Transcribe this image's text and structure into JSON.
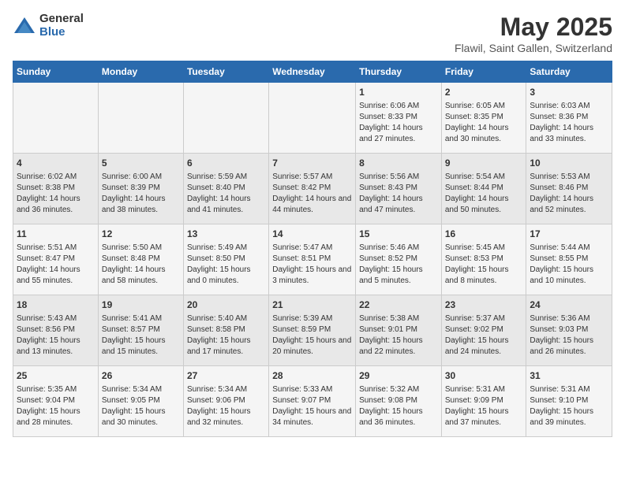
{
  "logo": {
    "general": "General",
    "blue": "Blue"
  },
  "header": {
    "title": "May 2025",
    "subtitle": "Flawil, Saint Gallen, Switzerland"
  },
  "weekdays": [
    "Sunday",
    "Monday",
    "Tuesday",
    "Wednesday",
    "Thursday",
    "Friday",
    "Saturday"
  ],
  "weeks": [
    [
      {
        "day": "",
        "content": ""
      },
      {
        "day": "",
        "content": ""
      },
      {
        "day": "",
        "content": ""
      },
      {
        "day": "",
        "content": ""
      },
      {
        "day": "1",
        "content": "Sunrise: 6:06 AM\nSunset: 8:33 PM\nDaylight: 14 hours and 27 minutes."
      },
      {
        "day": "2",
        "content": "Sunrise: 6:05 AM\nSunset: 8:35 PM\nDaylight: 14 hours and 30 minutes."
      },
      {
        "day": "3",
        "content": "Sunrise: 6:03 AM\nSunset: 8:36 PM\nDaylight: 14 hours and 33 minutes."
      }
    ],
    [
      {
        "day": "4",
        "content": "Sunrise: 6:02 AM\nSunset: 8:38 PM\nDaylight: 14 hours and 36 minutes."
      },
      {
        "day": "5",
        "content": "Sunrise: 6:00 AM\nSunset: 8:39 PM\nDaylight: 14 hours and 38 minutes."
      },
      {
        "day": "6",
        "content": "Sunrise: 5:59 AM\nSunset: 8:40 PM\nDaylight: 14 hours and 41 minutes."
      },
      {
        "day": "7",
        "content": "Sunrise: 5:57 AM\nSunset: 8:42 PM\nDaylight: 14 hours and 44 minutes."
      },
      {
        "day": "8",
        "content": "Sunrise: 5:56 AM\nSunset: 8:43 PM\nDaylight: 14 hours and 47 minutes."
      },
      {
        "day": "9",
        "content": "Sunrise: 5:54 AM\nSunset: 8:44 PM\nDaylight: 14 hours and 50 minutes."
      },
      {
        "day": "10",
        "content": "Sunrise: 5:53 AM\nSunset: 8:46 PM\nDaylight: 14 hours and 52 minutes."
      }
    ],
    [
      {
        "day": "11",
        "content": "Sunrise: 5:51 AM\nSunset: 8:47 PM\nDaylight: 14 hours and 55 minutes."
      },
      {
        "day": "12",
        "content": "Sunrise: 5:50 AM\nSunset: 8:48 PM\nDaylight: 14 hours and 58 minutes."
      },
      {
        "day": "13",
        "content": "Sunrise: 5:49 AM\nSunset: 8:50 PM\nDaylight: 15 hours and 0 minutes."
      },
      {
        "day": "14",
        "content": "Sunrise: 5:47 AM\nSunset: 8:51 PM\nDaylight: 15 hours and 3 minutes."
      },
      {
        "day": "15",
        "content": "Sunrise: 5:46 AM\nSunset: 8:52 PM\nDaylight: 15 hours and 5 minutes."
      },
      {
        "day": "16",
        "content": "Sunrise: 5:45 AM\nSunset: 8:53 PM\nDaylight: 15 hours and 8 minutes."
      },
      {
        "day": "17",
        "content": "Sunrise: 5:44 AM\nSunset: 8:55 PM\nDaylight: 15 hours and 10 minutes."
      }
    ],
    [
      {
        "day": "18",
        "content": "Sunrise: 5:43 AM\nSunset: 8:56 PM\nDaylight: 15 hours and 13 minutes."
      },
      {
        "day": "19",
        "content": "Sunrise: 5:41 AM\nSunset: 8:57 PM\nDaylight: 15 hours and 15 minutes."
      },
      {
        "day": "20",
        "content": "Sunrise: 5:40 AM\nSunset: 8:58 PM\nDaylight: 15 hours and 17 minutes."
      },
      {
        "day": "21",
        "content": "Sunrise: 5:39 AM\nSunset: 8:59 PM\nDaylight: 15 hours and 20 minutes."
      },
      {
        "day": "22",
        "content": "Sunrise: 5:38 AM\nSunset: 9:01 PM\nDaylight: 15 hours and 22 minutes."
      },
      {
        "day": "23",
        "content": "Sunrise: 5:37 AM\nSunset: 9:02 PM\nDaylight: 15 hours and 24 minutes."
      },
      {
        "day": "24",
        "content": "Sunrise: 5:36 AM\nSunset: 9:03 PM\nDaylight: 15 hours and 26 minutes."
      }
    ],
    [
      {
        "day": "25",
        "content": "Sunrise: 5:35 AM\nSunset: 9:04 PM\nDaylight: 15 hours and 28 minutes."
      },
      {
        "day": "26",
        "content": "Sunrise: 5:34 AM\nSunset: 9:05 PM\nDaylight: 15 hours and 30 minutes."
      },
      {
        "day": "27",
        "content": "Sunrise: 5:34 AM\nSunset: 9:06 PM\nDaylight: 15 hours and 32 minutes."
      },
      {
        "day": "28",
        "content": "Sunrise: 5:33 AM\nSunset: 9:07 PM\nDaylight: 15 hours and 34 minutes."
      },
      {
        "day": "29",
        "content": "Sunrise: 5:32 AM\nSunset: 9:08 PM\nDaylight: 15 hours and 36 minutes."
      },
      {
        "day": "30",
        "content": "Sunrise: 5:31 AM\nSunset: 9:09 PM\nDaylight: 15 hours and 37 minutes."
      },
      {
        "day": "31",
        "content": "Sunrise: 5:31 AM\nSunset: 9:10 PM\nDaylight: 15 hours and 39 minutes."
      }
    ]
  ]
}
